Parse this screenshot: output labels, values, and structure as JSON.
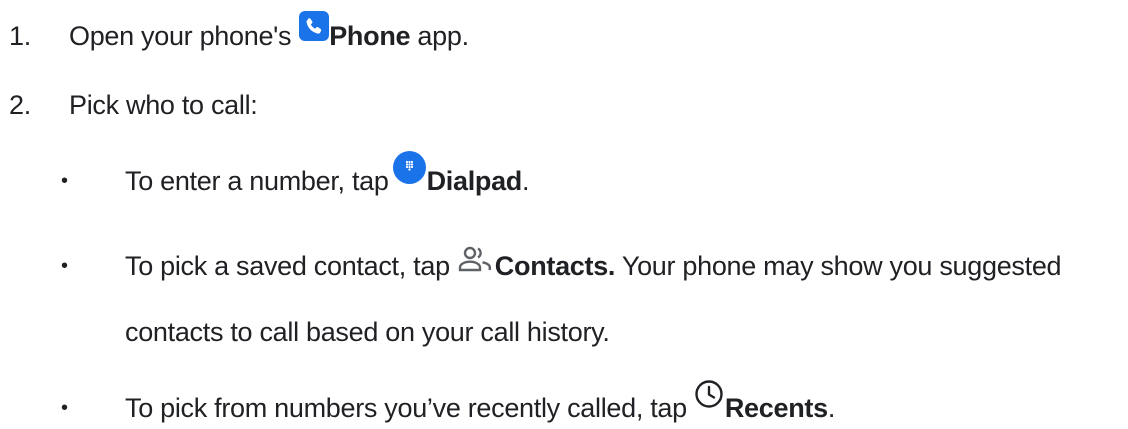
{
  "steps": [
    {
      "number": "1.",
      "before": "Open your phone's",
      "bold": "Phone",
      "after": " app."
    },
    {
      "number": "2.",
      "text": "Pick who to call:"
    }
  ],
  "bullets": [
    {
      "symbol": "•",
      "before": "To enter a number, tap",
      "bold": "Dialpad",
      "after": "."
    },
    {
      "symbol": "•",
      "before": "To pick a saved contact, tap",
      "bold": "Contacts.",
      "after": " Your phone may show you suggested",
      "continuation": "contacts to call based on your call history."
    },
    {
      "symbol": "•",
      "before": "To pick from numbers you’ve recently called, tap",
      "bold": "Recents",
      "after": "."
    }
  ],
  "icons": {
    "phone": "phone-app-icon",
    "dialpad": "dialpad-icon",
    "contacts": "contacts-icon",
    "recents": "recents-clock-icon"
  },
  "colors": {
    "text": "#202124",
    "phone_icon_bg": "#1a73e8",
    "dialpad_icon_bg": "#1a73e8",
    "contacts_icon": "#5f6368",
    "recents_icon": "#202124"
  }
}
